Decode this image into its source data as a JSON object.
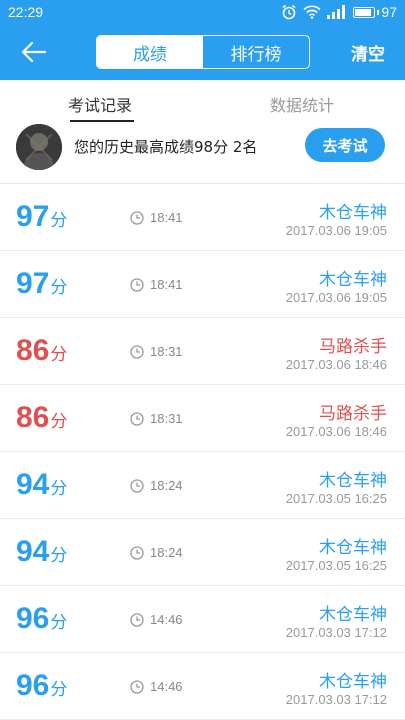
{
  "status_bar": {
    "time": "22:29",
    "battery": "97",
    "battery_level": 0.97
  },
  "app_bar": {
    "tabs": [
      "成绩",
      "排行榜"
    ],
    "active_tab": 0,
    "clear_label": "清空"
  },
  "sub_tabs": [
    "考试记录",
    "数据统计"
  ],
  "summary": {
    "text": "您的历史最高成绩98分 2名",
    "button_label": "去考试"
  },
  "colors": {
    "primary": "#2a9ff0",
    "fail": "#e05050"
  },
  "records": [
    {
      "score": "97",
      "unit": "分",
      "duration": "18:41",
      "title": "木仓车神",
      "date": "2017.03.06  19:05",
      "status": "pass"
    },
    {
      "score": "97",
      "unit": "分",
      "duration": "18:41",
      "title": "木仓车神",
      "date": "2017.03.06  19:05",
      "status": "pass"
    },
    {
      "score": "86",
      "unit": "分",
      "duration": "18:31",
      "title": "马路杀手",
      "date": "2017.03.06  18:46",
      "status": "fail"
    },
    {
      "score": "86",
      "unit": "分",
      "duration": "18:31",
      "title": "马路杀手",
      "date": "2017.03.06  18:46",
      "status": "fail"
    },
    {
      "score": "94",
      "unit": "分",
      "duration": "18:24",
      "title": "木仓车神",
      "date": "2017.03.05  16:25",
      "status": "pass"
    },
    {
      "score": "94",
      "unit": "分",
      "duration": "18:24",
      "title": "木仓车神",
      "date": "2017.03.05  16:25",
      "status": "pass"
    },
    {
      "score": "96",
      "unit": "分",
      "duration": "14:46",
      "title": "木仓车神",
      "date": "2017.03.03  17:12",
      "status": "pass"
    },
    {
      "score": "96",
      "unit": "分",
      "duration": "14:46",
      "title": "木仓车神",
      "date": "2017.03.03  17:12",
      "status": "pass"
    }
  ]
}
